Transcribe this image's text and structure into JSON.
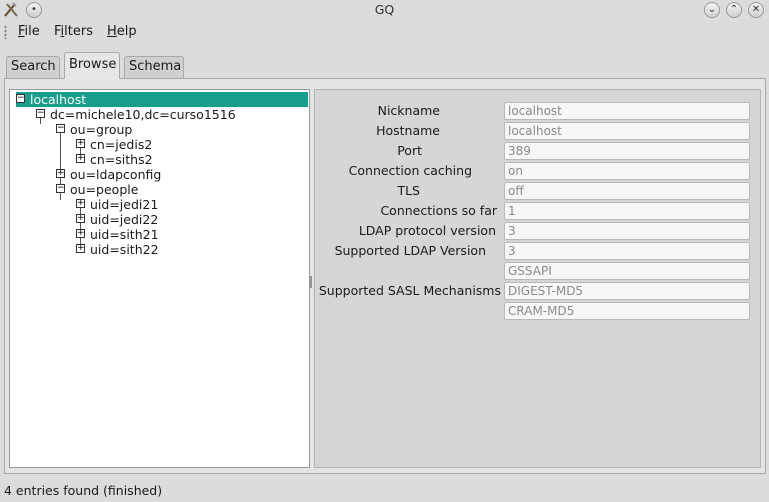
{
  "window": {
    "title": "GQ",
    "buttons": [
      "minimize",
      "maximize",
      "close"
    ]
  },
  "menubar": {
    "items": [
      {
        "label_u": "F",
        "label_rest": "ile"
      },
      {
        "label_u": "",
        "label_pre": "F",
        "label_under": "i",
        "label_rest": "lters"
      },
      {
        "label_u": "H",
        "label_rest": "elp"
      }
    ],
    "file": "File",
    "filters": "Filters",
    "help": "Help"
  },
  "tabs": [
    {
      "label": "Search",
      "active": false
    },
    {
      "label": "Browse",
      "active": true
    },
    {
      "label": "Schema",
      "active": false
    }
  ],
  "tree": {
    "nodes": [
      {
        "label": "localhost",
        "expander": "−",
        "selected": true
      },
      {
        "label": "dc=michele10,dc=curso1516",
        "expander": "−"
      },
      {
        "label": "ou=group",
        "expander": "−"
      },
      {
        "label": "cn=jedis2",
        "expander": "+"
      },
      {
        "label": "cn=siths2",
        "expander": "+"
      },
      {
        "label": "ou=ldapconfig",
        "expander": "+"
      },
      {
        "label": "ou=people",
        "expander": "−"
      },
      {
        "label": "uid=jedi21",
        "expander": "+"
      },
      {
        "label": "uid=jedi22",
        "expander": "+"
      },
      {
        "label": "uid=sith21",
        "expander": "+"
      },
      {
        "label": "uid=sith22",
        "expander": "+"
      }
    ]
  },
  "details": {
    "rows": [
      {
        "label": "Nickname",
        "value": "localhost"
      },
      {
        "label": "Hostname",
        "value": "localhost"
      },
      {
        "label": "Port",
        "value": "389"
      },
      {
        "label": "Connection caching",
        "value": "on"
      },
      {
        "label": "TLS",
        "value": "off"
      },
      {
        "label": "Connections so far",
        "value": "1"
      },
      {
        "label": "LDAP protocol version",
        "value": "3"
      },
      {
        "label": "Supported LDAP Version",
        "value": "3"
      }
    ],
    "sasl_label": "Supported SASL Mechanisms",
    "sasl_values": [
      "GSSAPI",
      "DIGEST-MD5",
      "CRAM-MD5"
    ]
  },
  "status": "4 entries found (finished)",
  "colors": {
    "selection": "#169d8c"
  }
}
